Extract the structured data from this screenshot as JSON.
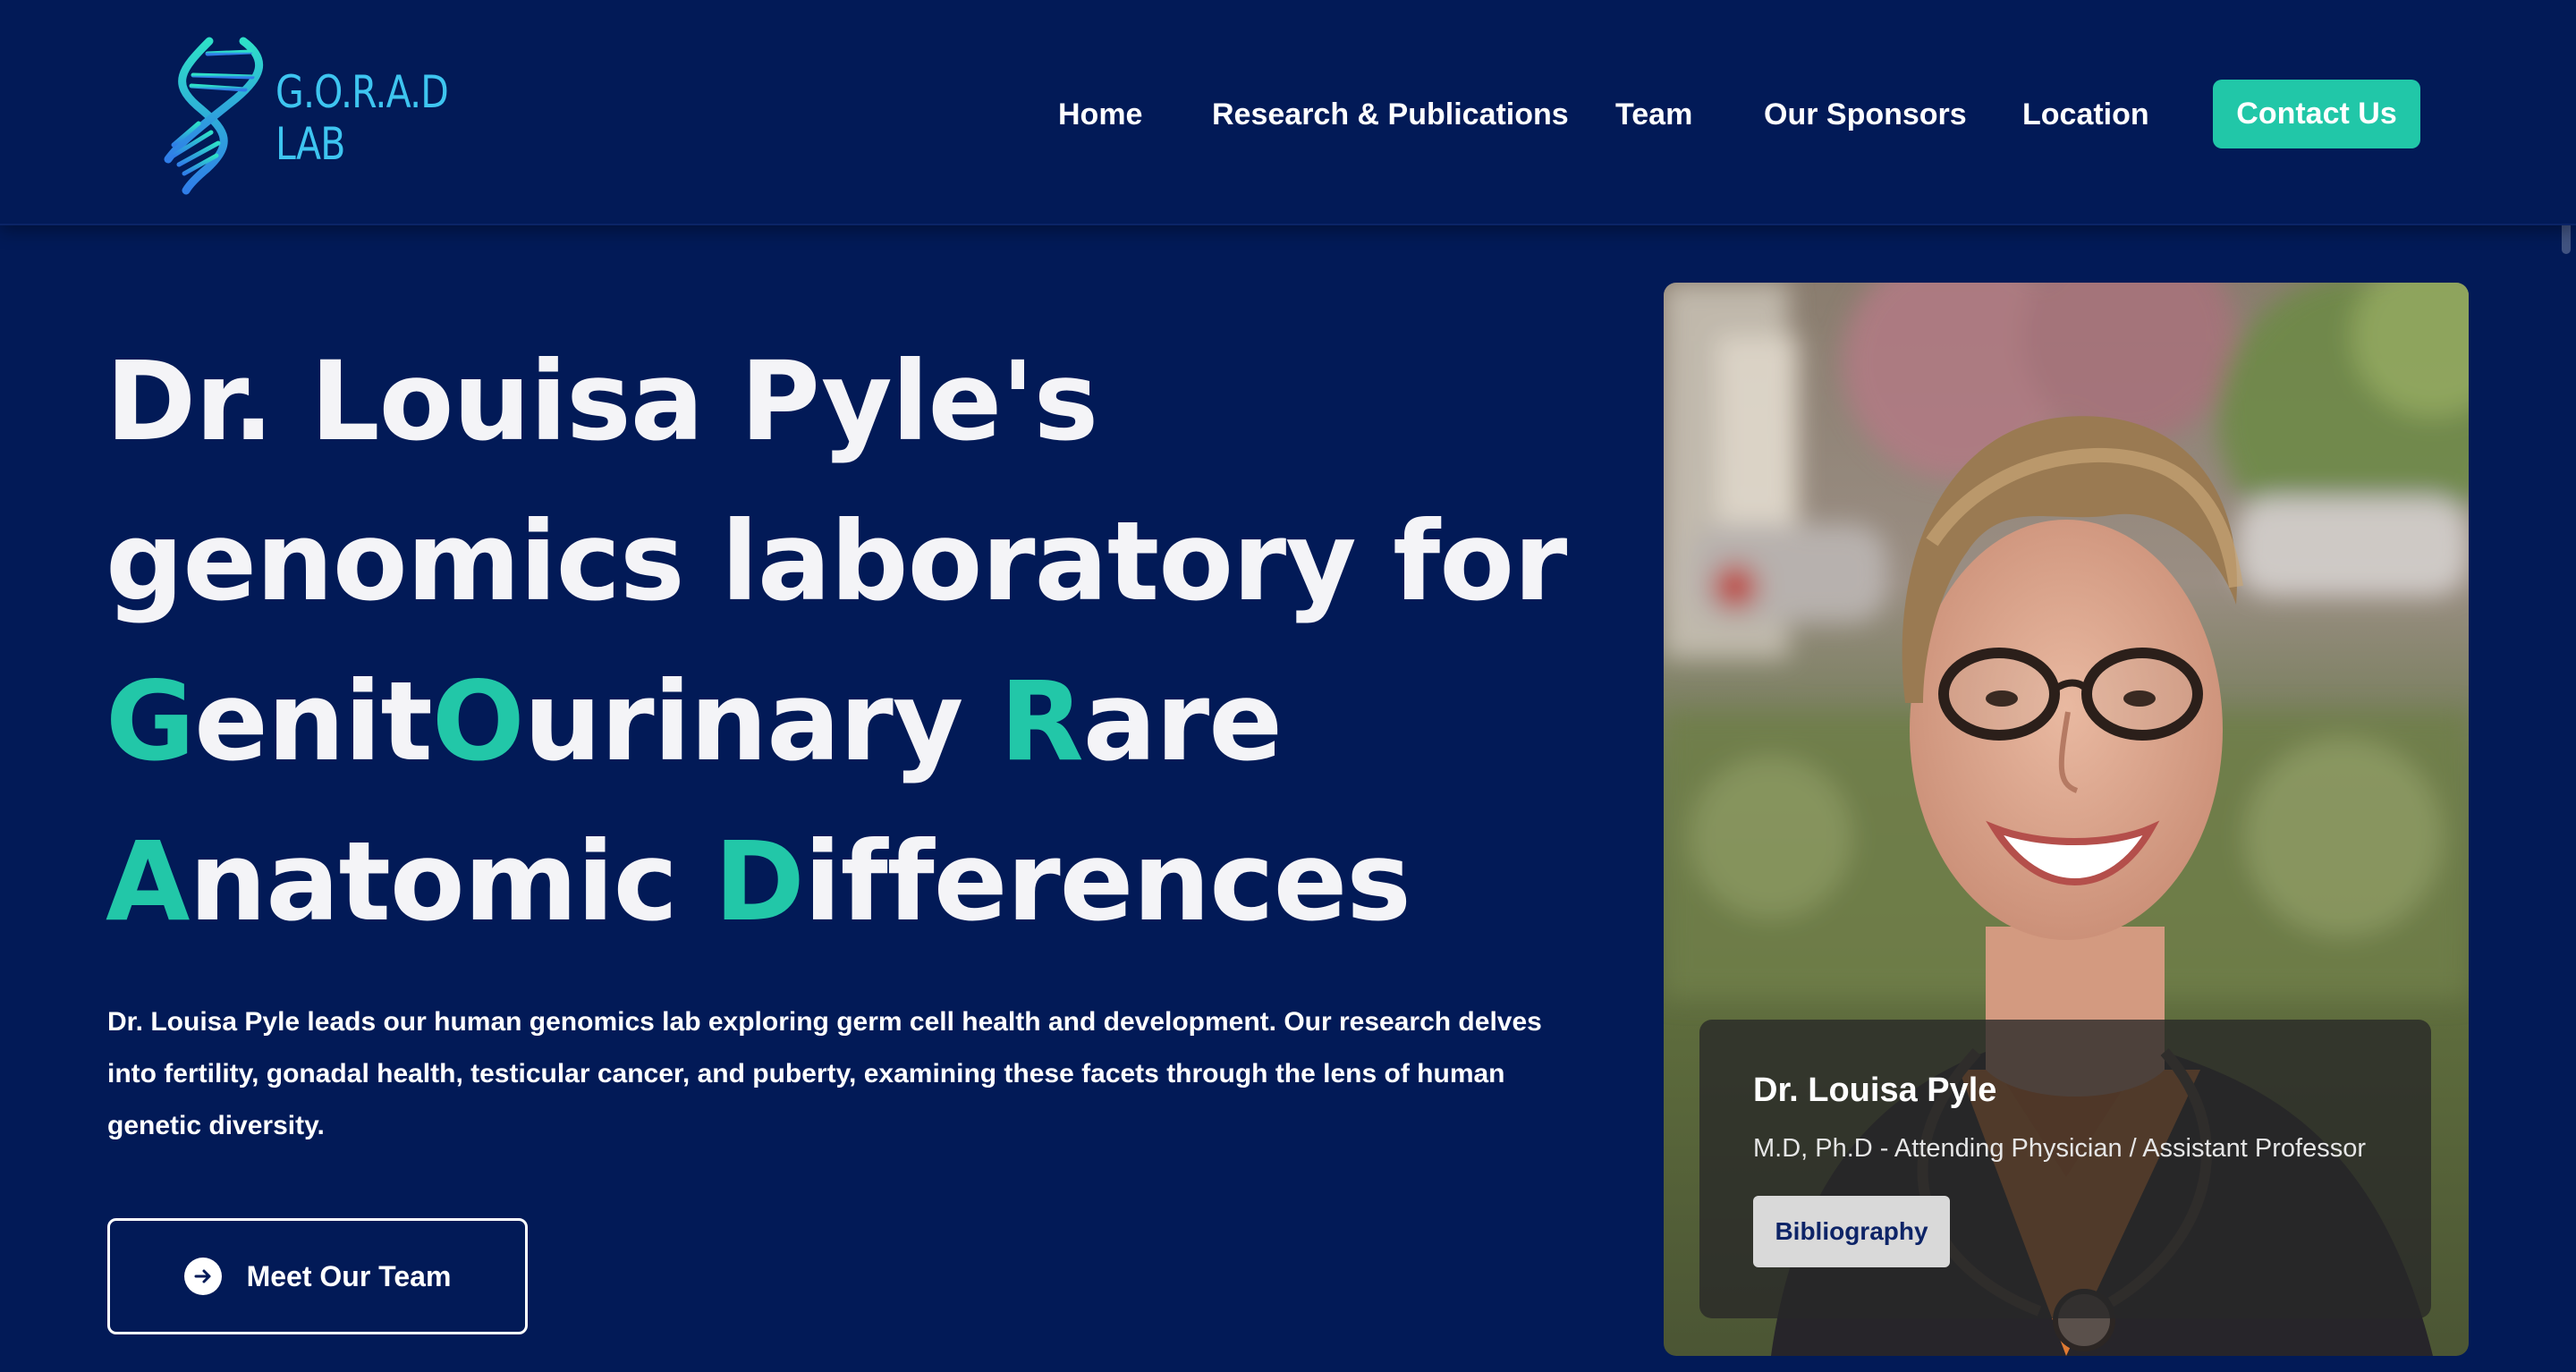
{
  "logo": {
    "icon": "dna-helix-icon",
    "line1": "G.O.R.A.D",
    "line2": "LAB"
  },
  "nav": {
    "items": [
      {
        "label": "Home"
      },
      {
        "label": "Research & Publications"
      },
      {
        "label": "Team"
      },
      {
        "label": "Our Sponsors"
      },
      {
        "label": "Location"
      }
    ],
    "contact_label": "Contact Us"
  },
  "hero": {
    "title_line1": "Dr. Louisa Pyle's",
    "title_line2": "genomics laboratory for",
    "title_line3": [
      {
        "text": "G",
        "highlight": true
      },
      {
        "text": "enit",
        "highlight": false
      },
      {
        "text": "O",
        "highlight": true
      },
      {
        "text": "urinary ",
        "highlight": false
      },
      {
        "text": "R",
        "highlight": true
      },
      {
        "text": "are",
        "highlight": false
      }
    ],
    "title_line4": [
      {
        "text": "A",
        "highlight": true
      },
      {
        "text": "natomic ",
        "highlight": false
      },
      {
        "text": "D",
        "highlight": true
      },
      {
        "text": "ifferences",
        "highlight": false
      }
    ],
    "description": "Dr. Louisa Pyle leads our human genomics lab exploring germ cell health and development. Our research delves into fertility, gonadal health, testicular cancer, and puberty, examining these facets through the lens of human genetic diversity.",
    "cta_label": "Meet Our Team",
    "cta_icon": "arrow-right-circle-icon"
  },
  "profile": {
    "name": "Dr. Louisa Pyle",
    "role": "M.D, Ph.D - Attending Physician / Assistant Professor",
    "button_label": "Bibliography"
  },
  "colors": {
    "background": "#021a57",
    "accent": "#21c7a8",
    "logo": "#3ec5f0",
    "text": "#ffffff"
  }
}
